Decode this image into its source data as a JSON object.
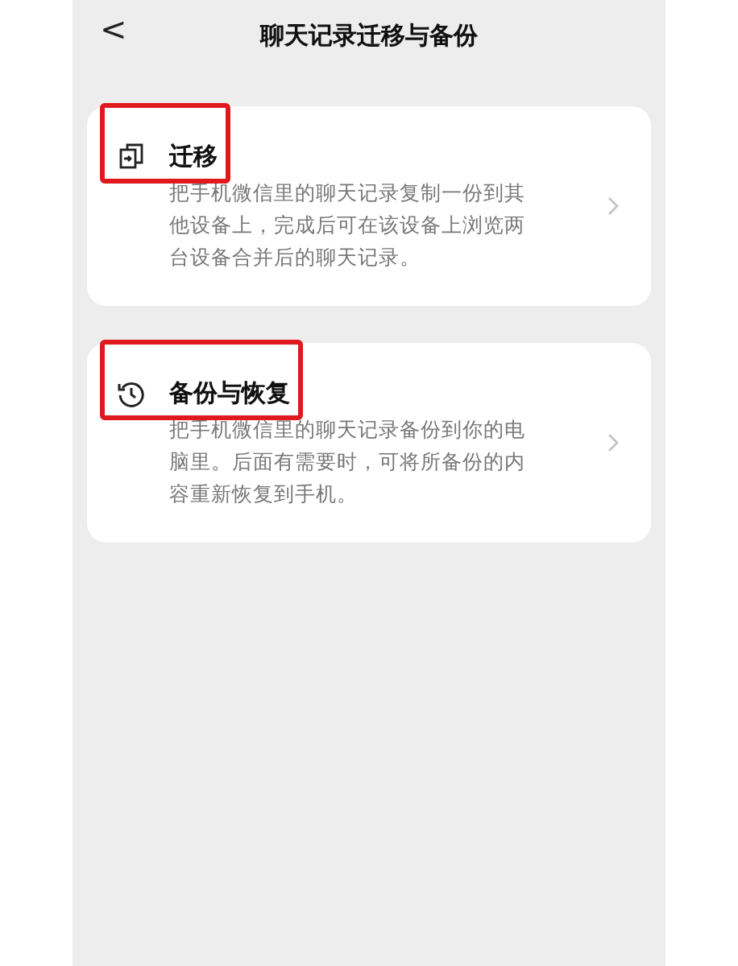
{
  "header": {
    "back": "<",
    "title": "聊天记录迁移与备份"
  },
  "options": [
    {
      "kind": "migrate",
      "title": "迁移",
      "description": "把手机微信里的聊天记录复制一份到其他设备上，完成后可在该设备上浏览两台设备合并后的聊天记录。",
      "highlighted": true
    },
    {
      "kind": "backup",
      "title": "备份与恢复",
      "description": "把手机微信里的聊天记录备份到你的电脑里。后面有需要时，可将所备份的内容重新恢复到手机。",
      "highlighted": true
    }
  ]
}
